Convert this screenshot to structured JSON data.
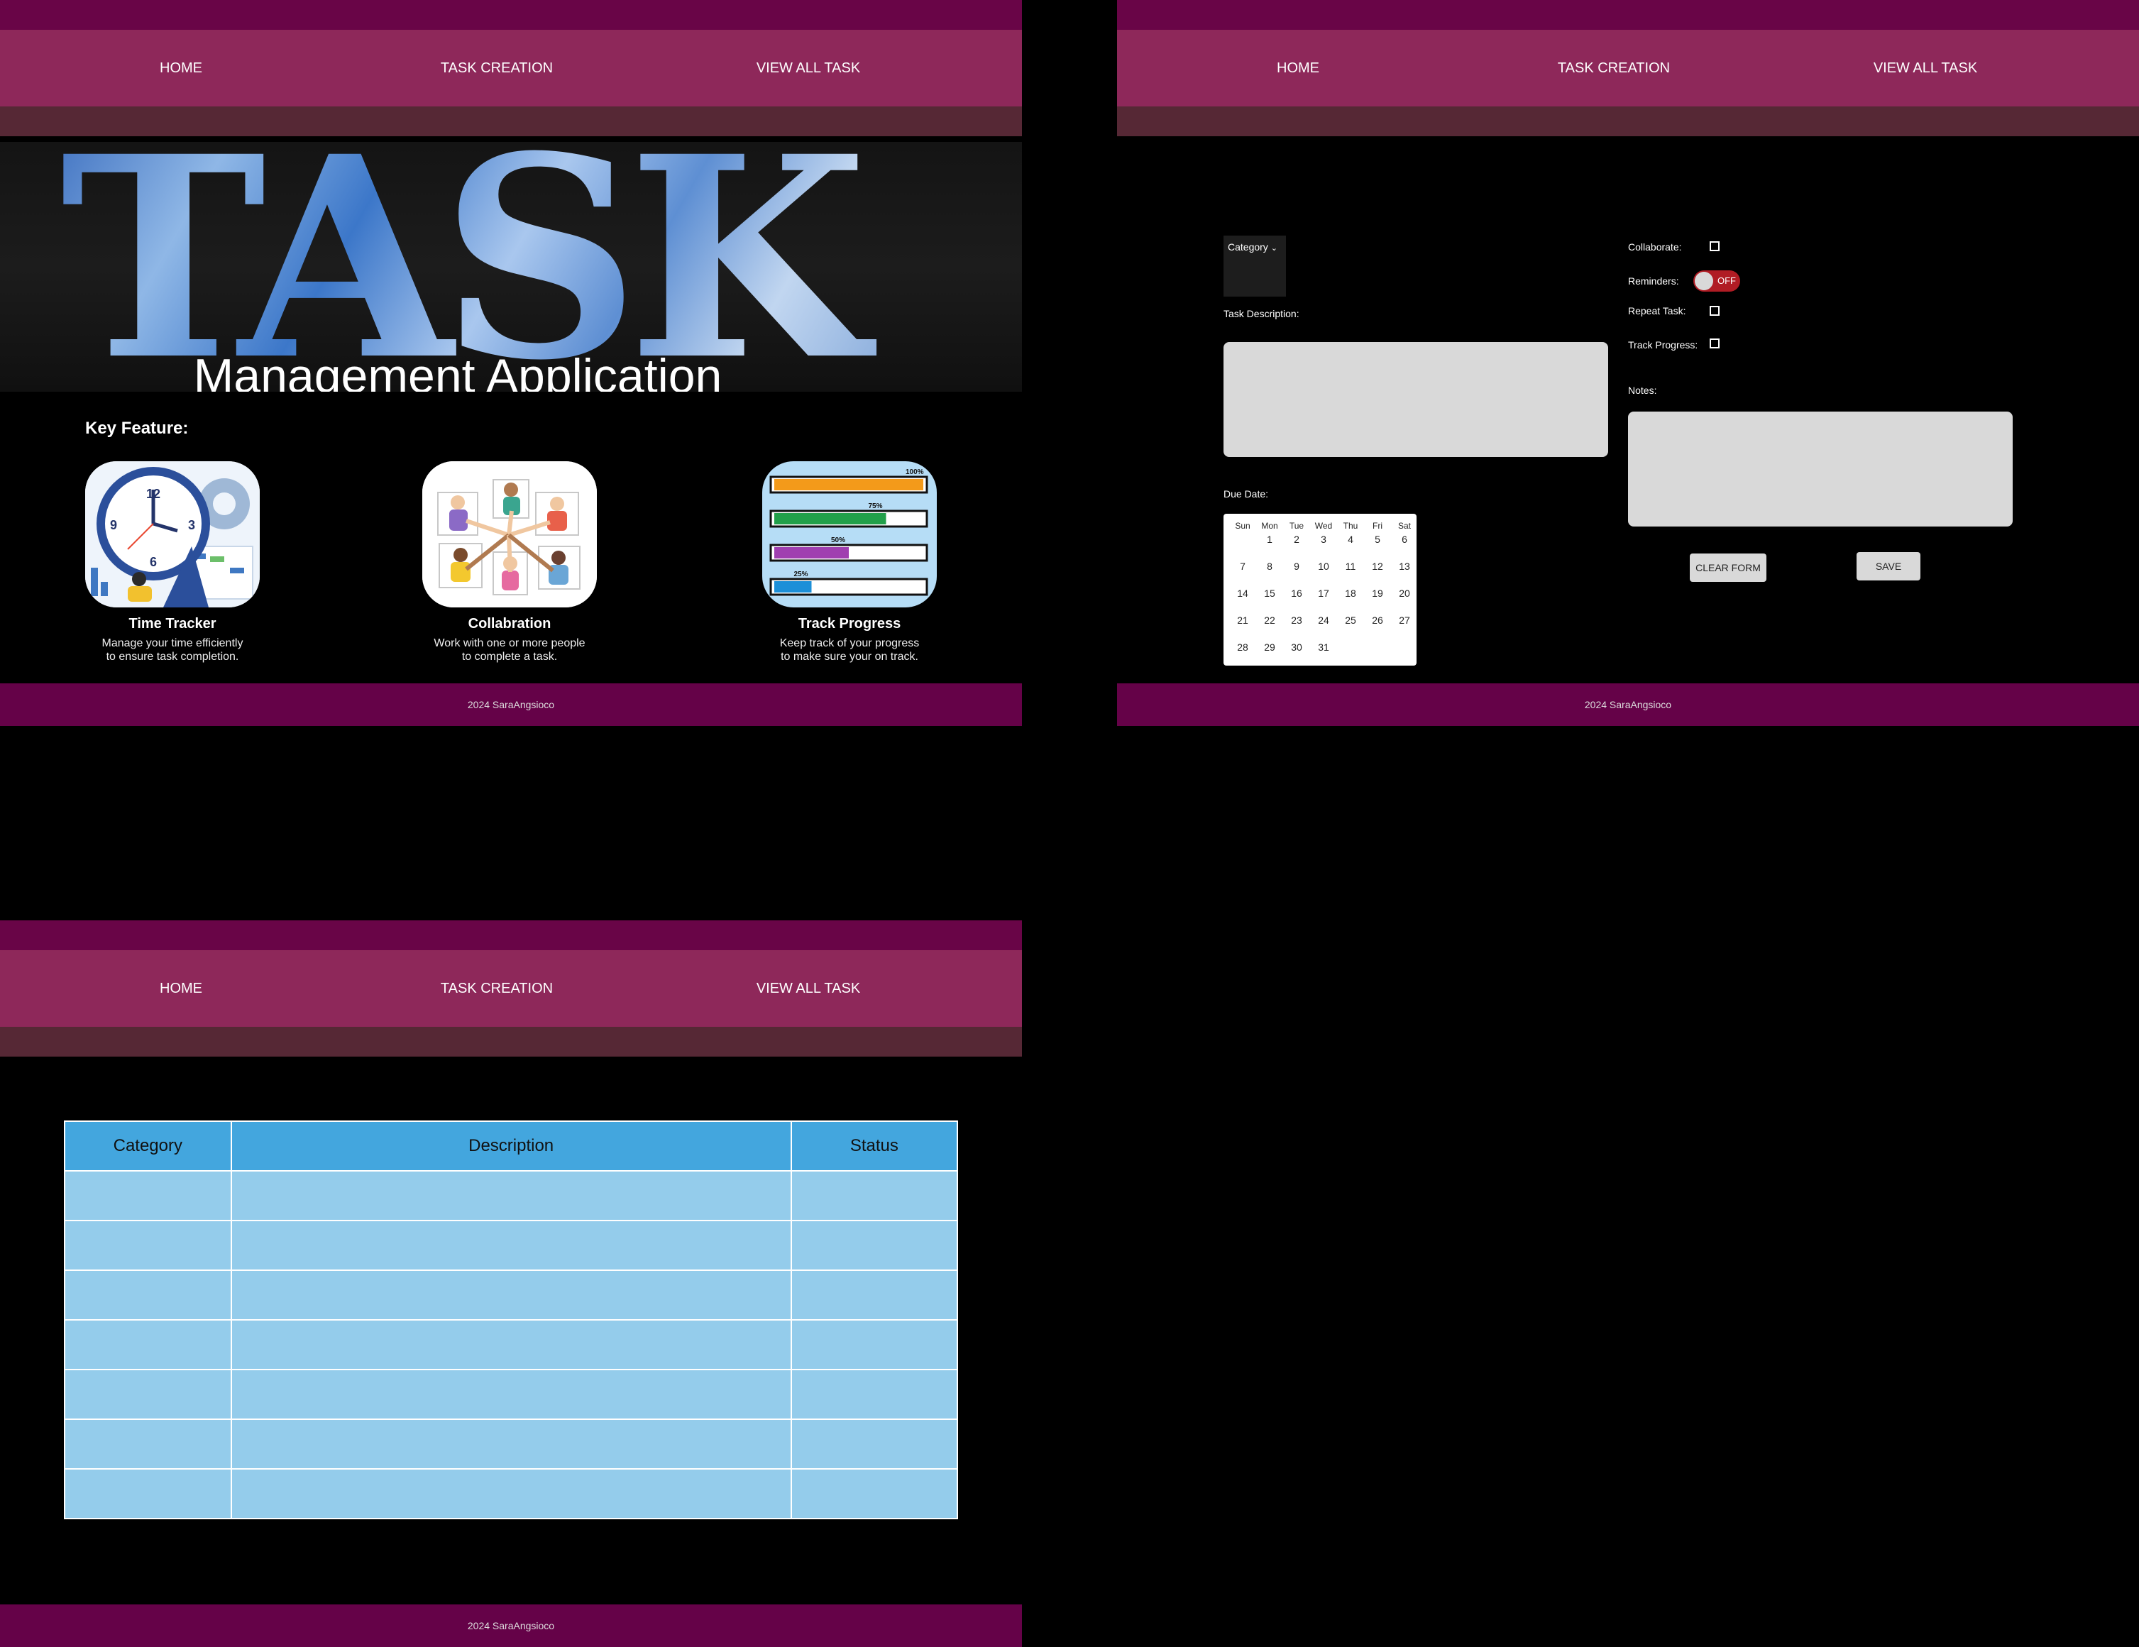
{
  "nav": {
    "home": "HOME",
    "task_creation": "TASK CREATION",
    "view_all": "VIEW ALL TASK"
  },
  "footer": "2024 SaraAngsioco",
  "home": {
    "hero_word": "TASK",
    "hero_subtitle": "Management Application",
    "key_feature_title": "Key Feature:",
    "features": [
      {
        "name": "Time Tracker",
        "desc_line1": "Manage your time efficiently",
        "desc_line2": "to ensure task completion."
      },
      {
        "name": "Collabration",
        "desc_line1": "Work with one or more people",
        "desc_line2": "to complete a task."
      },
      {
        "name": "Track Progress",
        "desc_line1": "Keep track of your progress",
        "desc_line2": "to make sure your on track."
      }
    ],
    "progress_bars": [
      {
        "label": "100%",
        "value": 1.0,
        "color": "#f39a1a"
      },
      {
        "label": "75%",
        "value": 0.75,
        "color": "#22a04a"
      },
      {
        "label": "50%",
        "value": 0.5,
        "color": "#a03fb0"
      },
      {
        "label": "25%",
        "value": 0.25,
        "color": "#1c8fd8"
      }
    ],
    "clock_numbers": {
      "n12": "12",
      "n3": "3",
      "n6": "6",
      "n9": "9"
    }
  },
  "create": {
    "category_label": "Category",
    "task_description_label": "Task Description:",
    "due_date_label": "Due Date:",
    "collaborate_label": "Collaborate:",
    "reminders_label": "Reminders:",
    "reminders_state": "OFF",
    "repeat_label": "Repeat Task:",
    "track_label": "Track Progress:",
    "notes_label": "Notes:",
    "clear_button": "CLEAR FORM",
    "save_button": "SAVE",
    "calendar": {
      "day_names": [
        "Sun",
        "Mon",
        "Tue",
        "Wed",
        "Thu",
        "Fri",
        "Sat"
      ],
      "first_weekday": 1,
      "days": 31
    }
  },
  "view": {
    "columns": [
      "Category",
      "Description",
      "Status"
    ],
    "row_count": 7
  },
  "colors": {
    "topbar": "#690547",
    "navbar": "#8e285a",
    "subbar": "#562835",
    "footer": "#650248",
    "table_header": "#43a6de",
    "table_cell": "#94cceb",
    "toggle_off": "#b01c24"
  }
}
